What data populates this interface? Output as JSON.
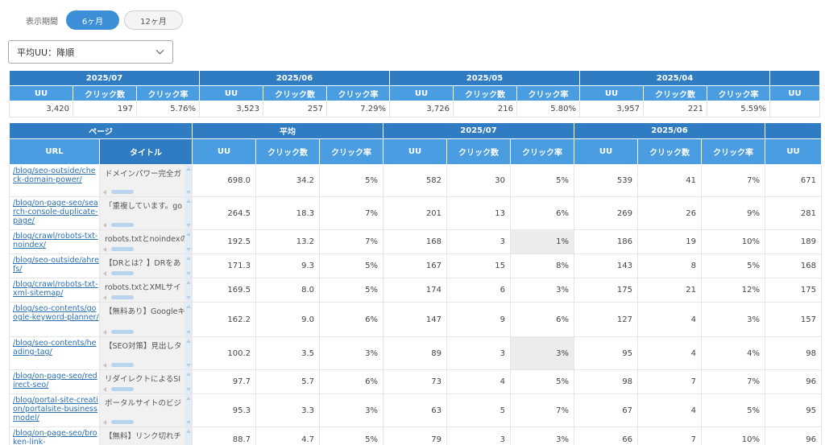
{
  "period": {
    "label": "表示期間",
    "options": [
      "6ヶ月",
      "12ヶ月"
    ],
    "selected": "6ヶ月"
  },
  "sort": {
    "selected": "平均UU：降順"
  },
  "summary": {
    "metric_labels": [
      "UU",
      "クリック数",
      "クリック率"
    ],
    "months": [
      {
        "month": "2025/07",
        "uu": "3,420",
        "clicks": "197",
        "ctr": "5.76%"
      },
      {
        "month": "2025/06",
        "uu": "3,523",
        "clicks": "257",
        "ctr": "7.29%"
      },
      {
        "month": "2025/05",
        "uu": "3,726",
        "clicks": "216",
        "ctr": "5.80%"
      },
      {
        "month": "2025/04",
        "uu": "3,957",
        "clicks": "221",
        "ctr": "5.59%"
      },
      {
        "month": "",
        "uu": "",
        "clicks": "",
        "ctr": ""
      }
    ],
    "partial_uu_label": "UU"
  },
  "table": {
    "page_group": "ページ",
    "url_header": "URL",
    "title_header": "タイトル",
    "avg_group": "平均",
    "month_groups": [
      "2025/07",
      "2025/06"
    ],
    "metric_labels": [
      "UU",
      "クリック数",
      "クリック率"
    ],
    "partial_uu_label": "UU",
    "rows": [
      {
        "url": "/blog/seo-outside/check-domain-power/",
        "title": "ドメインパワー完全ガ",
        "avg": [
          "698.0",
          "34.2",
          "5%"
        ],
        "m07": [
          "582",
          "30",
          "5%"
        ],
        "m06": [
          "539",
          "41",
          "7%"
        ],
        "next": "671"
      },
      {
        "url": "/blog/on-page-seo/search-console-duplicate-page/",
        "title": "「重複しています。go",
        "avg": [
          "264.5",
          "18.3",
          "7%"
        ],
        "m07": [
          "201",
          "13",
          "6%"
        ],
        "m06": [
          "269",
          "26",
          "9%"
        ],
        "next": "281"
      },
      {
        "url": "/blog/crawl/robots-txt-noindex/",
        "title": "robots.txtとnoindexの",
        "avg": [
          "192.5",
          "13.2",
          "7%"
        ],
        "m07": [
          "168",
          "3",
          "1%"
        ],
        "m06": [
          "186",
          "19",
          "10%"
        ],
        "next": "189",
        "hl": true
      },
      {
        "url": "/blog/seo-outside/ahrefs/",
        "title": "【DRとは？】DRをあ",
        "avg": [
          "171.3",
          "9.3",
          "5%"
        ],
        "m07": [
          "167",
          "15",
          "8%"
        ],
        "m06": [
          "143",
          "8",
          "5%"
        ],
        "next": "168"
      },
      {
        "url": "/blog/crawl/robots-txt-xml-sitemap/",
        "title": "robots.txtとXMLサイ",
        "avg": [
          "169.5",
          "8.0",
          "5%"
        ],
        "m07": [
          "174",
          "6",
          "3%"
        ],
        "m06": [
          "175",
          "21",
          "12%"
        ],
        "next": "175"
      },
      {
        "url": "/blog/seo-contents/google-keyword-planner/",
        "title": "【無料あり】Googleキ",
        "avg": [
          "162.2",
          "9.0",
          "6%"
        ],
        "m07": [
          "147",
          "9",
          "6%"
        ],
        "m06": [
          "127",
          "4",
          "3%"
        ],
        "next": "157"
      },
      {
        "url": "/blog/seo-contents/heading-tag/",
        "title": "【SEO対策】見出しタ",
        "avg": [
          "100.2",
          "3.5",
          "3%"
        ],
        "m07": [
          "89",
          "3",
          "3%"
        ],
        "m06": [
          "95",
          "4",
          "4%"
        ],
        "next": "98",
        "hl": true
      },
      {
        "url": "/blog/on-page-seo/redirect-seo/",
        "title": "リダイレクトによるSI",
        "avg": [
          "97.7",
          "5.7",
          "6%"
        ],
        "m07": [
          "73",
          "4",
          "5%"
        ],
        "m06": [
          "98",
          "7",
          "7%"
        ],
        "next": "96"
      },
      {
        "url": "/blog/portal-site-creation/portalsite-businessmodel/",
        "title": "ポータルサイトのビジ",
        "avg": [
          "95.3",
          "3.3",
          "3%"
        ],
        "m07": [
          "63",
          "5",
          "7%"
        ],
        "m06": [
          "67",
          "4",
          "5%"
        ],
        "next": "95"
      },
      {
        "url": "/blog/on-page-seo/broken-link-",
        "title": "【無料】リンク切れチ",
        "avg": [
          "88.7",
          "4.7",
          "5%"
        ],
        "m07": [
          "79",
          "3",
          "3%"
        ],
        "m06": [
          "66",
          "7",
          "10%"
        ],
        "next": "96"
      }
    ]
  },
  "colors": {
    "header_dark": "#2f7cc2",
    "header_light": "#4a9de0",
    "pill_active": "#3c8fd6",
    "link": "#2b6fb3",
    "highlight_cell": "#ececec"
  }
}
